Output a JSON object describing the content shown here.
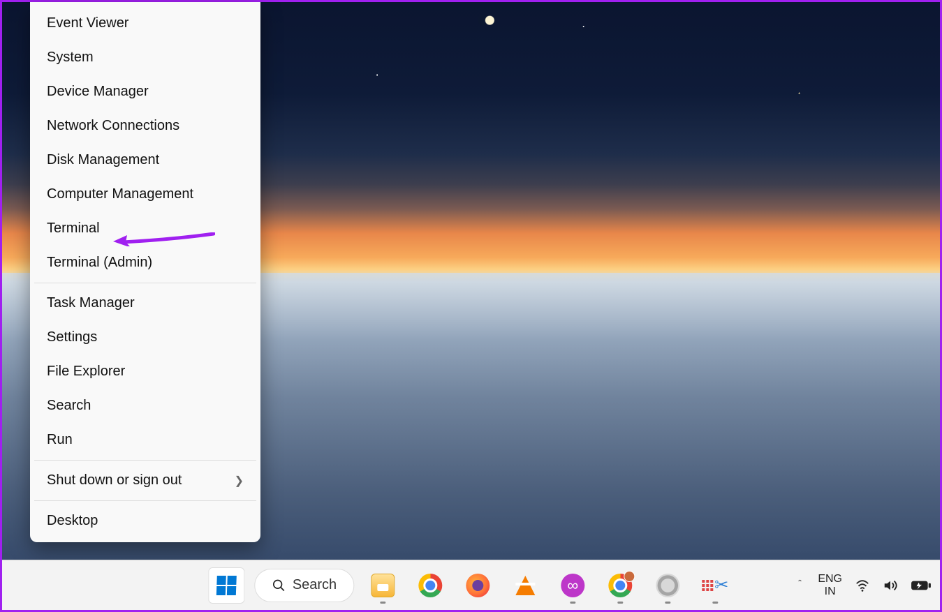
{
  "context_menu": {
    "groups": [
      [
        "Event Viewer",
        "System",
        "Device Manager",
        "Network Connections",
        "Disk Management",
        "Computer Management",
        "Terminal",
        "Terminal (Admin)"
      ],
      [
        "Task Manager",
        "Settings",
        "File Explorer",
        "Search",
        "Run"
      ],
      [
        {
          "label": "Shut down or sign out",
          "submenu": true
        }
      ],
      [
        "Desktop"
      ]
    ],
    "highlighted": "Terminal"
  },
  "taskbar": {
    "search_label": "Search",
    "icons": [
      "file-explorer",
      "chrome",
      "firefox",
      "vlc",
      "mask-recorder",
      "chrome-profile",
      "settings-gear",
      "snipping-tool"
    ]
  },
  "tray": {
    "lang_top": "ENG",
    "lang_bottom": "IN"
  },
  "annotation": {
    "arrow_color": "#a020f0",
    "points_to": "Terminal"
  }
}
